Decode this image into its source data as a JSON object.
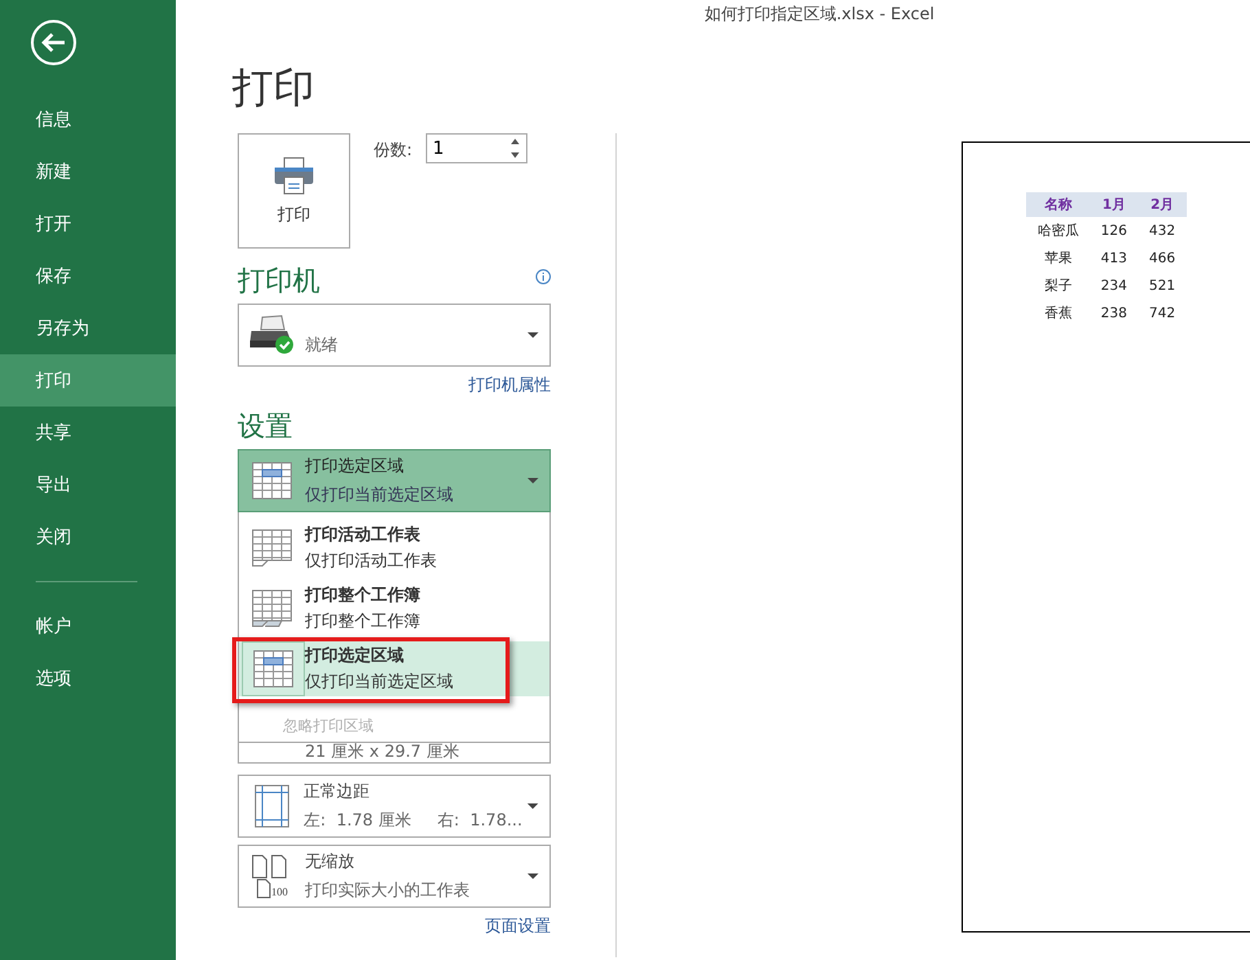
{
  "window": {
    "title": "如何打印指定区域.xlsx - Excel"
  },
  "sidebar": {
    "items": [
      {
        "label": "信息",
        "selected": false
      },
      {
        "label": "新建",
        "selected": false
      },
      {
        "label": "打开",
        "selected": false
      },
      {
        "label": "保存",
        "selected": false
      },
      {
        "label": "另存为",
        "selected": false
      },
      {
        "label": "打印",
        "selected": true
      },
      {
        "label": "共享",
        "selected": false
      },
      {
        "label": "导出",
        "selected": false
      },
      {
        "label": "关闭",
        "selected": false
      }
    ],
    "footer_items": [
      {
        "label": "帐户",
        "selected": false
      },
      {
        "label": "选项",
        "selected": false
      }
    ]
  },
  "page_title": "打印",
  "print_button": {
    "label": "打印"
  },
  "copies": {
    "label": "份数:",
    "value": "1"
  },
  "printer": {
    "heading": "打印机",
    "status": "就绪",
    "properties_link": "打印机属性"
  },
  "settings": {
    "heading": "设置",
    "selected_option": {
      "title": "打印选定区域",
      "subtitle": "仅打印当前选定区域"
    },
    "menu": [
      {
        "title": "打印活动工作表",
        "subtitle": "仅打印活动工作表",
        "kind": "sheet",
        "selected": false,
        "highlighted": false
      },
      {
        "title": "打印整个工作簿",
        "subtitle": "打印整个工作簿",
        "kind": "workbook",
        "selected": false,
        "highlighted": false
      },
      {
        "title": "打印选定区域",
        "subtitle": "仅打印当前选定区域",
        "kind": "selection",
        "selected": true,
        "highlighted": true
      }
    ],
    "ignore_print_area": {
      "label": "忽略打印区域",
      "disabled": true
    },
    "paper_size": {
      "subtitle": "21 厘米 x 29.7 厘米"
    },
    "margins": {
      "title": "正常边距",
      "subtitle": "左:  1.78 厘米     右:  1.78..."
    },
    "scaling": {
      "title": "无缩放",
      "subtitle": "打印实际大小的工作表",
      "icon_text": "100"
    },
    "page_setup_link": "页面设置"
  },
  "preview": {
    "columns": [
      "名称",
      "1月",
      "2月"
    ],
    "rows": [
      [
        "哈密瓜",
        "126",
        "432"
      ],
      [
        "苹果",
        "413",
        "466"
      ],
      [
        "梨子",
        "234",
        "521"
      ],
      [
        "香蕉",
        "238",
        "742"
      ]
    ]
  }
}
